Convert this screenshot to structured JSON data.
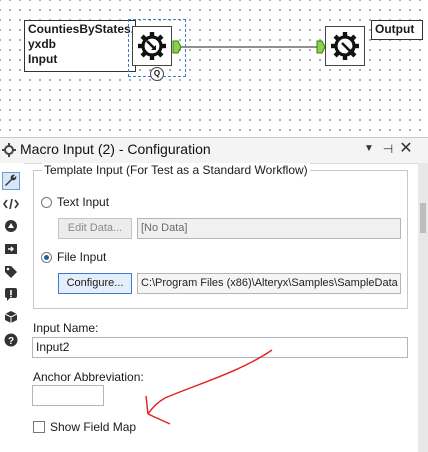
{
  "canvas": {
    "input_node_label": "CountiesByStates.\nyxdb\nInput",
    "output_node_label": "Output",
    "input_badge": "Q"
  },
  "panel": {
    "title": "Macro Input (2) - Configuration",
    "header_buttons": {
      "menu": "▼",
      "pin": "⊣",
      "close": "✕"
    },
    "side_icons": [
      "configuration-wrench-icon",
      "xml-code-icon",
      "meta-info-icon",
      "annotation-arrow-icon",
      "tag-icon",
      "error-icon",
      "layout-box-icon",
      "help-icon"
    ],
    "template_group": {
      "legend": "Template Input (For Test as a Standard Workflow)",
      "text_input": {
        "label": "Text Input",
        "selected": false,
        "edit_button": "Edit Data...",
        "data_field": "[No Data]"
      },
      "file_input": {
        "label": "File Input",
        "selected": true,
        "configure_button": "Configure...",
        "path_field": "C:\\Program Files (x86)\\Alteryx\\Samples\\SampleData"
      }
    },
    "input_name": {
      "label": "Input Name:",
      "value": "Input2"
    },
    "anchor_abbreviation": {
      "label": "Anchor Abbreviation:",
      "value": ""
    },
    "show_field_map": {
      "label": "Show Field Map",
      "checked": false
    }
  },
  "colors": {
    "accent": "#3a7bd5",
    "annotation": "#e02020",
    "anchor_green": "#8ad24a"
  }
}
